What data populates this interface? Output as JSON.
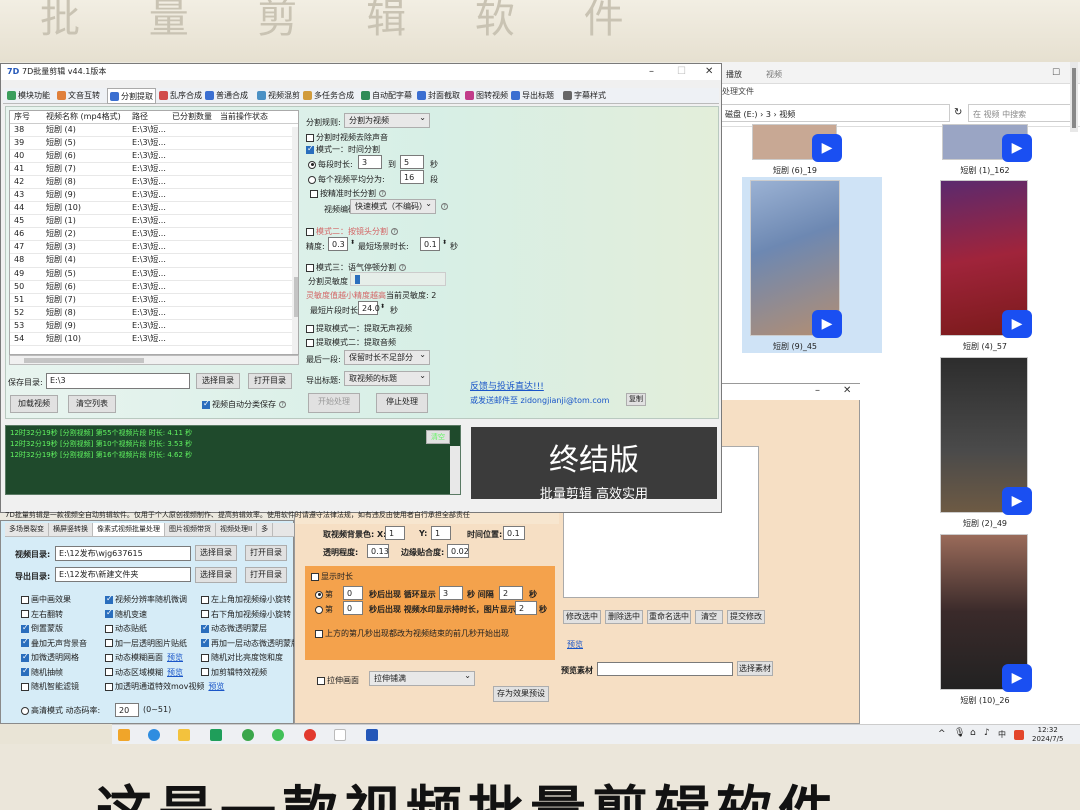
{
  "overlay": {
    "top_text": "批 量 剪 辑 软 件",
    "bottom_text": "这是一款视频批量剪辑软件"
  },
  "explorer": {
    "tab_active": "播放",
    "tab_other": "视频",
    "tab3": "处理文件",
    "address": "磁盘 (E:) › 3 › 视频",
    "search_placeholder": "在 视频 中搜索",
    "files": [
      {
        "name": "短剧 (6)_19"
      },
      {
        "name": "短剧 (1)_162"
      },
      {
        "name": "短剧 (9)_45"
      },
      {
        "name": "短剧 (4)_57"
      },
      {
        "name": "短剧 (2)_49"
      },
      {
        "name": "短剧 (10)_26"
      }
    ]
  },
  "main_window": {
    "title": "7D批量剪辑    v44.1版本",
    "tabs": [
      "模块功能",
      "文音互转",
      "分割提取",
      "乱序合成",
      "普通合成",
      "视频混剪",
      "多任务合成",
      "自动配字幕",
      "封面截取",
      "图转视频",
      "导出标题",
      "字幕样式"
    ],
    "grid_headers": [
      "序号",
      "视频名称 (mp4格式)",
      "路径",
      "已分割数量",
      "当前操作状态"
    ],
    "rows": [
      {
        "no": "38",
        "name": "短剧 (4)",
        "path": "E:\\3\\短..."
      },
      {
        "no": "39",
        "name": "短剧 (5)",
        "path": "E:\\3\\短..."
      },
      {
        "no": "40",
        "name": "短剧 (6)",
        "path": "E:\\3\\短..."
      },
      {
        "no": "41",
        "name": "短剧 (7)",
        "path": "E:\\3\\短..."
      },
      {
        "no": "42",
        "name": "短剧 (8)",
        "path": "E:\\3\\短..."
      },
      {
        "no": "43",
        "name": "短剧 (9)",
        "path": "E:\\3\\短..."
      },
      {
        "no": "44",
        "name": "短剧 (10)",
        "path": "E:\\3\\短..."
      },
      {
        "no": "45",
        "name": "短剧 (1)",
        "path": "E:\\3\\短..."
      },
      {
        "no": "46",
        "name": "短剧 (2)",
        "path": "E:\\3\\短..."
      },
      {
        "no": "47",
        "name": "短剧 (3)",
        "path": "E:\\3\\短..."
      },
      {
        "no": "48",
        "name": "短剧 (4)",
        "path": "E:\\3\\短..."
      },
      {
        "no": "49",
        "name": "短剧 (5)",
        "path": "E:\\3\\短..."
      },
      {
        "no": "50",
        "name": "短剧 (6)",
        "path": "E:\\3\\短..."
      },
      {
        "no": "51",
        "name": "短剧 (7)",
        "path": "E:\\3\\短..."
      },
      {
        "no": "52",
        "name": "短剧 (8)",
        "path": "E:\\3\\短..."
      },
      {
        "no": "53",
        "name": "短剧 (9)",
        "path": "E:\\3\\短..."
      },
      {
        "no": "54",
        "name": "短剧 (10)",
        "path": "E:\\3\\短..."
      }
    ],
    "save_dir_label": "保存目录:",
    "save_dir_value": "E:\\3",
    "choose_dir": "选择目录",
    "open_dir": "打开目录",
    "load_video": "加载视频",
    "clear_list": "清空列表",
    "auto_save": "视频自动分类保存",
    "split_rule_label": "分割规则:",
    "split_rule_value": "分割为视频",
    "remove_audio": "分割时视频去除声音",
    "mode1": "模式一：时间分割",
    "each_duration": "每段时长:",
    "dur_from": "3",
    "dur_to_label": "到",
    "dur_to": "5",
    "sec": "秒",
    "avg_split": "每个视频平均分为:",
    "avg_value": "16",
    "segments": "段",
    "precise": "按精准时长分割",
    "encode_label": "视频编码:",
    "encode_value": "快速模式（不编码）",
    "mode2": "模式二：按镜头分割",
    "precision_label": "精度:",
    "precision_value": "0.3",
    "min_shot_label": "最短场景时长:",
    "min_shot_value": "0.1",
    "mode3": "模式三：语气停顿分割",
    "sensitivity_label": "分割灵敏度",
    "sensitivity_hint": "灵敏度值越小精度越高",
    "current_sensitivity": "当前灵敏度: 2",
    "min_seg_label": "最短片段时长:",
    "min_seg_value": "24.0",
    "extract1": "提取模式一：提取无声视频",
    "extract2": "提取模式二：提取音频",
    "last_seg_label": "最后一段:",
    "last_seg_value": "保留时长不足部分",
    "export_title_label": "导出标题:",
    "export_title_value": "取视频的标题",
    "feedback": "反馈与投诉直达!!!",
    "email_line": "或发送邮件至 zidongjianji@tom.com",
    "copy": "复制",
    "start": "开始处理",
    "stop": "停止处理",
    "log": [
      "12时32分19秒 [分割视频] 第55个视频片段 时长: 4.11 秒",
      "12时32分19秒 [分割视频] 第10个视频片段 时长: 3.53 秒",
      "12时32分19秒 [分割视频] 第16个视频片段 时长: 4.62 秒"
    ],
    "clear_log": "清空",
    "banner_title": "终结版",
    "banner_sub": "批量剪辑 高效实用",
    "footer": "7D批量剪辑是一款视频全自动剪辑软件。仅用于个人原创视频制作、提高剪辑效率。使用软件时请遵守法律法规，如有违反由使用者自行承担全部责任"
  },
  "second_window": {
    "tabs": [
      "多场景裂变",
      "横屏竖转换",
      "像素式视频批量处理",
      "图片视频带货",
      "视频处理II",
      "多"
    ],
    "video_dir_label": "视频目录:",
    "video_dir_value": "E:\\12发布\\wjg637615",
    "export_dir_label": "导出目录:",
    "export_dir_value": "E:\\12发布\\新建文件夹",
    "choose_dir": "选择目录",
    "open_dir": "打开目录",
    "options": [
      {
        "label": "画中画效果",
        "on": false
      },
      {
        "label": "视频分辨率随机微调",
        "on": true
      },
      {
        "label": "左上角加视频缘小旋转",
        "on": false
      },
      {
        "label": "左右翻转",
        "on": false
      },
      {
        "label": "随机变速",
        "on": true
      },
      {
        "label": "右下角加视频缘小旋转",
        "on": false
      },
      {
        "label": "倒置蒙版",
        "on": true
      },
      {
        "label": "动态贴纸",
        "on": false
      },
      {
        "label": "动态微透明蒙层",
        "on": true
      },
      {
        "label": "叠加无声背景音",
        "on": true
      },
      {
        "label": "加一层透明图片贴纸",
        "on": false
      },
      {
        "label": "再加一层动态微透明蒙版",
        "on": true
      },
      {
        "label": "加微透明网格",
        "on": true
      },
      {
        "label": "动态模糊画面",
        "on": false
      },
      {
        "label": "随机对比亮度饱和度",
        "on": false
      },
      {
        "label": "随机抽帧",
        "on": true
      },
      {
        "label": "动态区域模糊",
        "on": false
      },
      {
        "label": "加剪辑特效视频",
        "on": false
      },
      {
        "label": "随机智能滤镜",
        "on": false
      },
      {
        "label": "加透明通道特效mov视频",
        "on": false
      }
    ],
    "preview": "预览",
    "hd_label": "高清模式 动态码率:",
    "hd_value": "20",
    "hd_range": "(0~51)"
  },
  "orange_window": {
    "bg_color_label": "取视频背景色: X:",
    "x_val": "1",
    "y_label": "Y:",
    "y_val": "1",
    "time_pos_label": "时间位置:",
    "time_pos_val": "0.1",
    "transparency_label": "透明程度:",
    "transparency_val": "0.13",
    "edge_label": "边缘贴合度:",
    "edge_val": "0.02",
    "show_duration": "显示时长",
    "row1_pre": "第",
    "row1_a": "0",
    "row1_mid": "秒后出现 循环显示",
    "row1_b": "3",
    "row1_c": "秒 间隔",
    "row1_d": "2",
    "row1_e": "秒",
    "row2_a": "0",
    "row2_mid": "秒后出现 视频水印显示持时长，图片显示",
    "row2_b": "2",
    "row2_c": "秒",
    "tail_option": "上方的第几秒出现都改为视频结束的前几秒开始出现",
    "edit_selected": "修改选中",
    "delete_selected": "删除选中",
    "rename_selected": "重命名选中",
    "clear": "清空",
    "submit_edit": "提交修改",
    "preview": "预览",
    "preview_material": "预览素材",
    "choose_material": "选择素材",
    "stretch_label": "拉伸画面",
    "stretch_value": "拉伸铺满",
    "save_preset": "存为效果预设"
  },
  "taskbar": {
    "time": "12:32",
    "date": "2024/7/5",
    "lang": "中"
  }
}
